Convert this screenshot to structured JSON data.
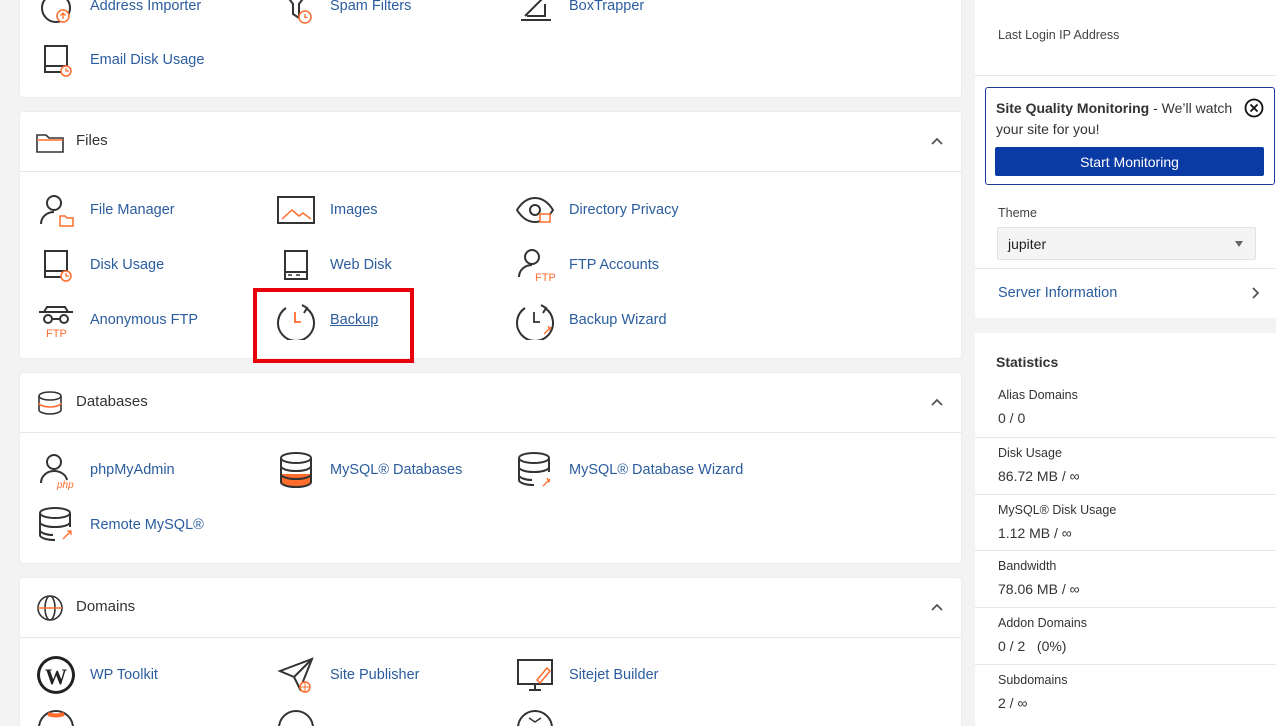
{
  "email_section": {
    "items": [
      {
        "label": "Address Importer"
      },
      {
        "label": "Spam Filters"
      },
      {
        "label": "BoxTrapper"
      },
      {
        "label": "Email Disk Usage"
      }
    ]
  },
  "files_section": {
    "title": "Files",
    "items": [
      {
        "label": "File Manager"
      },
      {
        "label": "Images"
      },
      {
        "label": "Directory Privacy"
      },
      {
        "label": "Disk Usage"
      },
      {
        "label": "Web Disk"
      },
      {
        "label": "FTP Accounts"
      },
      {
        "label": "Anonymous FTP"
      },
      {
        "label": "Backup"
      },
      {
        "label": "Backup Wizard"
      }
    ]
  },
  "databases_section": {
    "title": "Databases",
    "items": [
      {
        "label": "phpMyAdmin"
      },
      {
        "label": "MySQL® Databases"
      },
      {
        "label": "MySQL® Database Wizard"
      },
      {
        "label": "Remote MySQL®"
      }
    ]
  },
  "domains_section": {
    "title": "Domains",
    "items": [
      {
        "label": "WP Toolkit"
      },
      {
        "label": "Site Publisher"
      },
      {
        "label": "Sitejet Builder"
      }
    ]
  },
  "sidebar": {
    "last_login_label": "Last Login IP Address",
    "sqm": {
      "title": "Site Quality Monitoring",
      "text": " - We’ll watch your site for you!",
      "button": "Start Monitoring"
    },
    "theme_label": "Theme",
    "theme_value": "jupiter",
    "server_info": "Server Information",
    "statistics": {
      "title": "Statistics",
      "items": [
        {
          "label": "Alias Domains",
          "value": "0 / 0"
        },
        {
          "label": "Disk Usage",
          "value": "86.72 MB / ∞"
        },
        {
          "label": "MySQL® Disk Usage",
          "value": "1.12 MB / ∞"
        },
        {
          "label": "Bandwidth",
          "value": "78.06 MB / ∞"
        },
        {
          "label": "Addon Domains",
          "value": "0 / 2   (0%)"
        },
        {
          "label": "Subdomains",
          "value": "2 / ∞"
        }
      ]
    }
  },
  "colors": {
    "accent": "#ff6c2c",
    "link": "#2b5d9e",
    "primary_button": "#0a3aa3",
    "highlight": "#e8000b"
  }
}
